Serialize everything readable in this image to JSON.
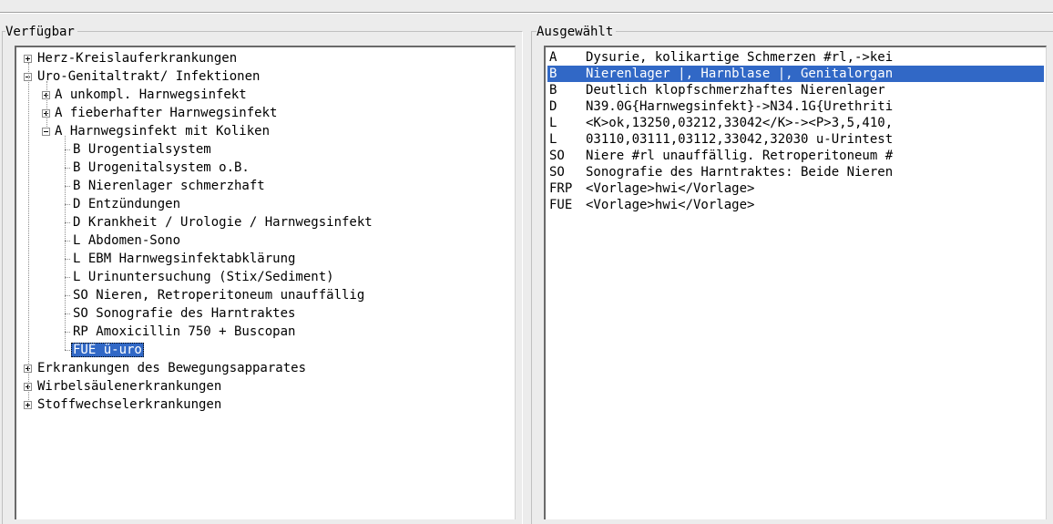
{
  "verfuegbar": {
    "label": "Verfügbar",
    "tree": [
      {
        "text": "Herz-Kreislauferkrankungen",
        "depth": 0,
        "expander": "plus"
      },
      {
        "text": "Uro-Genitaltrakt/ Infektionen",
        "depth": 0,
        "expander": "minus"
      },
      {
        "text": "A unkompl. Harnwegsinfekt",
        "depth": 1,
        "expander": "plus"
      },
      {
        "text": "A fieberhafter Harnwegsinfekt",
        "depth": 1,
        "expander": "plus"
      },
      {
        "text": "A Harnwegsinfekt mit Koliken",
        "depth": 1,
        "expander": "minus"
      },
      {
        "text": "B Urogentialsystem",
        "depth": 2
      },
      {
        "text": "B Urogenitalsystem o.B.",
        "depth": 2
      },
      {
        "text": "B Nierenlager schmerzhaft",
        "depth": 2
      },
      {
        "text": "D Entzündungen",
        "depth": 2
      },
      {
        "text": "D Krankheit / Urologie / Harnwegsinfekt",
        "depth": 2
      },
      {
        "text": "L Abdomen-Sono",
        "depth": 2
      },
      {
        "text": "L EBM Harnwegsinfektabklärung",
        "depth": 2
      },
      {
        "text": "L Urinuntersuchung (Stix/Sediment)",
        "depth": 2
      },
      {
        "text": "SO Nieren, Retroperitoneum unauffällig",
        "depth": 2
      },
      {
        "text": "SO Sonografie des Harntraktes",
        "depth": 2
      },
      {
        "text": "RP Amoxicillin 750 + Buscopan",
        "depth": 2
      },
      {
        "text": "FUE ü-uro",
        "depth": 2,
        "selected": true
      },
      {
        "text": "Erkrankungen des Bewegungsapparates",
        "depth": 0,
        "expander": "plus"
      },
      {
        "text": "Wirbelsäulenerkrankungen",
        "depth": 0,
        "expander": "plus"
      },
      {
        "text": "Stoffwechselerkrankungen",
        "depth": 0,
        "expander": "plus"
      }
    ]
  },
  "ausgewaehlt": {
    "label": "Ausgewählt",
    "rows": [
      {
        "code": "A",
        "text": "Dysurie, kolikartige Schmerzen #rl,->kei"
      },
      {
        "code": "B",
        "text": "Nierenlager |, Harnblase |, Genitalorgan",
        "selected": true
      },
      {
        "code": "B",
        "text": "Deutlich klopfschmerzhaftes Nierenlager"
      },
      {
        "code": "D",
        "text": "N39.0G{Harnwegsinfekt}->N34.1G{Urethriti"
      },
      {
        "code": "L",
        "text": "<K>ok,13250,03212,33042</K>-><P>3,5,410,"
      },
      {
        "code": "L",
        "text": "03110,03111,03112,33042,32030 u-Urintest"
      },
      {
        "code": "SO",
        "text": "Niere #rl unauffällig. Retroperitoneum #"
      },
      {
        "code": "SO",
        "text": "Sonografie des Harntraktes: Beide Nieren"
      },
      {
        "code": "FRP",
        "text": "<Vorlage>hwi</Vorlage>"
      },
      {
        "code": "FUE",
        "text": "<Vorlage>hwi</Vorlage>"
      }
    ]
  },
  "colors": {
    "selection": "#3168c6",
    "background": "#ececec"
  }
}
